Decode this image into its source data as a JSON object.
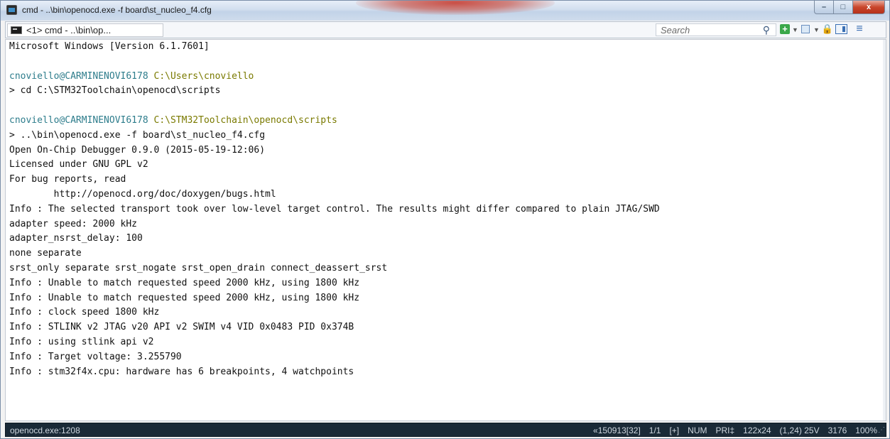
{
  "window": {
    "title": "cmd - ..\\bin\\openocd.exe  -f board\\st_nucleo_f4.cfg",
    "buttons": {
      "minimize": "–",
      "maximize": "□",
      "close": "x"
    }
  },
  "tabbar": {
    "tab_label": "<1> cmd - ..\\bin\\op...",
    "search_placeholder": "Search"
  },
  "console": {
    "lines": [
      "Microsoft Windows [Version 6.1.7601]",
      "",
      "",
      "> cd C:\\STM32Toolchain\\openocd\\scripts",
      "",
      "",
      "> ..\\bin\\openocd.exe -f board\\st_nucleo_f4.cfg",
      "Open On-Chip Debugger 0.9.0 (2015-05-19-12:06)",
      "Licensed under GNU GPL v2",
      "For bug reports, read",
      "        http://openocd.org/doc/doxygen/bugs.html",
      "Info : The selected transport took over low-level target control. The results might differ compared to plain JTAG/SWD",
      "adapter speed: 2000 kHz",
      "adapter_nsrst_delay: 100",
      "none separate",
      "srst_only separate srst_nogate srst_open_drain connect_deassert_srst",
      "Info : Unable to match requested speed 2000 kHz, using 1800 kHz",
      "Info : Unable to match requested speed 2000 kHz, using 1800 kHz",
      "Info : clock speed 1800 kHz",
      "Info : STLINK v2 JTAG v20 API v2 SWIM v4 VID 0x0483 PID 0x374B",
      "Info : using stlink api v2",
      "Info : Target voltage: 3.255790",
      "Info : stm32f4x.cpu: hardware has 6 breakpoints, 4 watchpoints"
    ],
    "prompt1_user": "cnoviello@CARMINENOVI6178",
    "prompt1_path": "C:\\Users\\cnoviello",
    "prompt2_user": "cnoviello@CARMINENOVI6178",
    "prompt2_path": "C:\\STM32Toolchain\\openocd\\scripts"
  },
  "statusbar": {
    "process": "openocd.exe:1208",
    "info": "«150913[32]",
    "pos": "1/1",
    "plus": "[+]",
    "num": "NUM",
    "pri": "PRI‡",
    "size": "122x24",
    "cursor": "(1,24) 25V",
    "mem": "3176",
    "zoom": "100%"
  },
  "colors": {
    "path": "#7a7a00",
    "user": "#2e7d8c",
    "status_bg": "#1a2a37"
  }
}
